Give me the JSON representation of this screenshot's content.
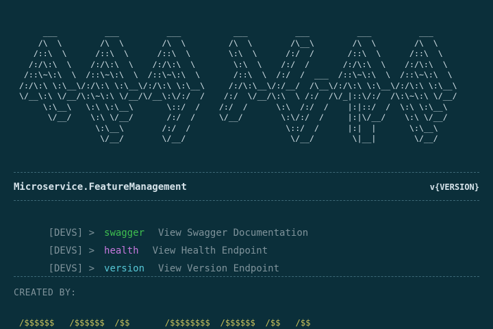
{
  "banner": {
    "ascii_art": "     ___          ___          ___           ___          ___          ___          ___\n    /\\  \\        /\\  \\        /\\  \\         /\\  \\        /\\__\\        /\\  \\        /\\  \\\n   /::\\  \\      /::\\  \\      /::\\  \\        \\:\\  \\      /:/  /       /::\\  \\      /::\\  \\\n  /:/\\:\\  \\    /:/\\:\\  \\    /:/\\:\\  \\        \\:\\  \\    /:/  /       /:/\\:\\  \\    /:/\\:\\  \\\n /::\\~\\:\\  \\  /::\\~\\:\\  \\  /::\\~\\:\\  \\       /::\\  \\  /:/  /  ___  /::\\~\\:\\  \\  /::\\~\\:\\  \\\n/:/\\:\\ \\:\\__\\/:/\\:\\ \\:\\__\\/:/\\:\\ \\:\\__\\     /:/\\:\\__\\/:/__/  /\\__\\/:/\\:\\ \\:\\__\\/:/\\:\\ \\:\\__\\\n\\/__\\:\\ \\/__/\\:\\~\\:\\ \\/__/\\/__\\:\\/:/  /    /:/  \\/__/\\:\\  \\ /:/  /\\/_|::\\/:/  /\\:\\~\\:\\ \\/__/\n     \\:\\__\\   \\:\\ \\:\\__\\       \\::/  /    /:/  /      \\:\\  /:/  /    |:|::/  /  \\:\\ \\:\\__\\\n      \\/__/    \\:\\ \\/__/       /:/  /     \\/__/        \\:\\/:/  /     |:|\\/__/    \\:\\ \\/__/\n                \\:\\__\\        /:/  /                    \\::/  /      |:|  |       \\:\\__\\\n                 \\/__/        \\/__/                      \\/__/        \\|__|        \\/__/"
  },
  "header": {
    "service_name": "Microservice.FeatureManagement",
    "version": "v{VERSION}"
  },
  "commands": [
    {
      "prefix": "[DEVS] >",
      "name": "swagger",
      "description": "View Swagger Documentation",
      "color": "#3fbf4f"
    },
    {
      "prefix": "[DEVS] >",
      "name": "health",
      "description": "View Health Endpoint",
      "color": "#c678dd"
    },
    {
      "prefix": "[DEVS] >",
      "name": "version",
      "description": "View Version Endpoint",
      "color": "#56c7d6"
    }
  ],
  "footer": {
    "created_by_label": "CREATED BY:",
    "signature_ascii": "/$$$$$$   /$$$$$$  /$$       /$$$$$$$$  /$$$$$$  /$$   /$$"
  },
  "colors": {
    "background": "#0b2f3a",
    "text": "#d6e3ea",
    "muted": "#7f939b",
    "signature": "#c7c05a"
  }
}
